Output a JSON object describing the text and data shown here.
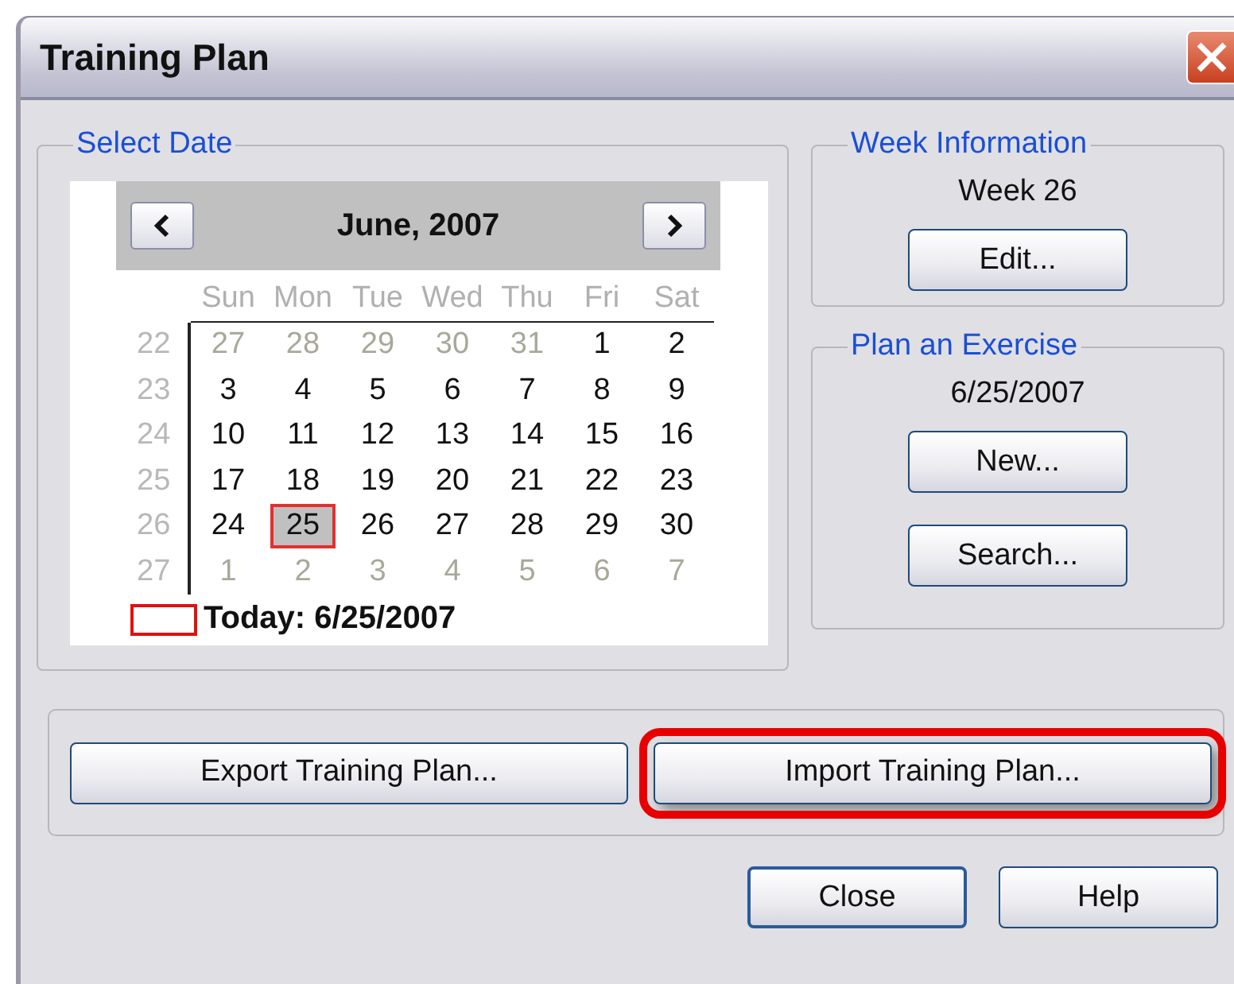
{
  "window": {
    "title": "Training Plan"
  },
  "select_date": {
    "title": "Select Date",
    "calendar": {
      "month": "June, 2007",
      "day_names": [
        "Sun",
        "Mon",
        "Tue",
        "Wed",
        "Thu",
        "Fri",
        "Sat"
      ],
      "weeks": [
        {
          "number": "22",
          "days": [
            {
              "label": "27",
              "in_month": false,
              "selected": false
            },
            {
              "label": "28",
              "in_month": false,
              "selected": false
            },
            {
              "label": "29",
              "in_month": false,
              "selected": false
            },
            {
              "label": "30",
              "in_month": false,
              "selected": false
            },
            {
              "label": "31",
              "in_month": false,
              "selected": false
            },
            {
              "label": "1",
              "in_month": true,
              "selected": false
            },
            {
              "label": "2",
              "in_month": true,
              "selected": false
            }
          ]
        },
        {
          "number": "23",
          "days": [
            {
              "label": "3",
              "in_month": true,
              "selected": false
            },
            {
              "label": "4",
              "in_month": true,
              "selected": false
            },
            {
              "label": "5",
              "in_month": true,
              "selected": false
            },
            {
              "label": "6",
              "in_month": true,
              "selected": false
            },
            {
              "label": "7",
              "in_month": true,
              "selected": false
            },
            {
              "label": "8",
              "in_month": true,
              "selected": false
            },
            {
              "label": "9",
              "in_month": true,
              "selected": false
            }
          ]
        },
        {
          "number": "24",
          "days": [
            {
              "label": "10",
              "in_month": true,
              "selected": false
            },
            {
              "label": "11",
              "in_month": true,
              "selected": false
            },
            {
              "label": "12",
              "in_month": true,
              "selected": false
            },
            {
              "label": "13",
              "in_month": true,
              "selected": false
            },
            {
              "label": "14",
              "in_month": true,
              "selected": false
            },
            {
              "label": "15",
              "in_month": true,
              "selected": false
            },
            {
              "label": "16",
              "in_month": true,
              "selected": false
            }
          ]
        },
        {
          "number": "25",
          "days": [
            {
              "label": "17",
              "in_month": true,
              "selected": false
            },
            {
              "label": "18",
              "in_month": true,
              "selected": false
            },
            {
              "label": "19",
              "in_month": true,
              "selected": false
            },
            {
              "label": "20",
              "in_month": true,
              "selected": false
            },
            {
              "label": "21",
              "in_month": true,
              "selected": false
            },
            {
              "label": "22",
              "in_month": true,
              "selected": false
            },
            {
              "label": "23",
              "in_month": true,
              "selected": false
            }
          ]
        },
        {
          "number": "26",
          "days": [
            {
              "label": "24",
              "in_month": true,
              "selected": false
            },
            {
              "label": "25",
              "in_month": true,
              "selected": true
            },
            {
              "label": "26",
              "in_month": true,
              "selected": false
            },
            {
              "label": "27",
              "in_month": true,
              "selected": false
            },
            {
              "label": "28",
              "in_month": true,
              "selected": false
            },
            {
              "label": "29",
              "in_month": true,
              "selected": false
            },
            {
              "label": "30",
              "in_month": true,
              "selected": false
            }
          ]
        },
        {
          "number": "27",
          "days": [
            {
              "label": "1",
              "in_month": false,
              "selected": false
            },
            {
              "label": "2",
              "in_month": false,
              "selected": false
            },
            {
              "label": "3",
              "in_month": false,
              "selected": false
            },
            {
              "label": "4",
              "in_month": false,
              "selected": false
            },
            {
              "label": "5",
              "in_month": false,
              "selected": false
            },
            {
              "label": "6",
              "in_month": false,
              "selected": false
            },
            {
              "label": "7",
              "in_month": false,
              "selected": false
            }
          ]
        }
      ],
      "today": "Today: 6/25/2007"
    }
  },
  "week_information": {
    "title": "Week Information",
    "week": "Week 26",
    "buttons": [
      {
        "label": "Edit..."
      }
    ]
  },
  "plan_exercise": {
    "title": "Plan an Exercise",
    "date": "6/25/2007",
    "buttons": [
      {
        "label": "New..."
      },
      {
        "label": "Search..."
      }
    ]
  },
  "transfer_buttons": [
    {
      "label": "Export Training Plan...",
      "highlighted": false
    },
    {
      "label": "Import Training Plan...",
      "highlighted": true
    }
  ],
  "dialog_buttons": [
    {
      "label": "Close",
      "default": true
    },
    {
      "label": "Help",
      "default": false
    }
  ]
}
